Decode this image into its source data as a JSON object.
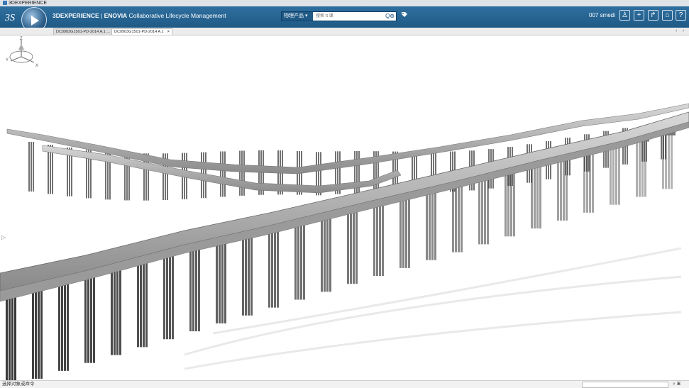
{
  "window": {
    "title": "3DEXPERIENCE"
  },
  "topbar": {
    "brand_prefix": "3DEXPERIENCE",
    "brand_sep": " | ",
    "brand_app": "ENOVIA",
    "brand_desc": " Collaborative Lifecycle Management",
    "search_scope": "物理产品",
    "search_placeholder": "搜索 tt 课",
    "search_icon": "search-icon",
    "tag_icon": "tag-icon",
    "user": "007 smedi",
    "buttons": [
      "user-icon",
      "add-icon",
      "share-icon",
      "home-icon",
      "help-icon"
    ]
  },
  "tabs": [
    {
      "label": "DC0903G1501-PD-2014 A.1 ...",
      "active": false
    },
    {
      "label": "DC0903G1501-PD-2014 A.1",
      "active": true,
      "close": "×"
    }
  ],
  "viewport": {
    "compass_labels": {
      "z": "Z",
      "y": "Y",
      "x": "X"
    }
  },
  "status": {
    "text": "选择对象或命令"
  },
  "colors": {
    "topbar": "#1f5a86",
    "accent": "#2f6f9f",
    "model_gray": "#8c8c8c"
  }
}
